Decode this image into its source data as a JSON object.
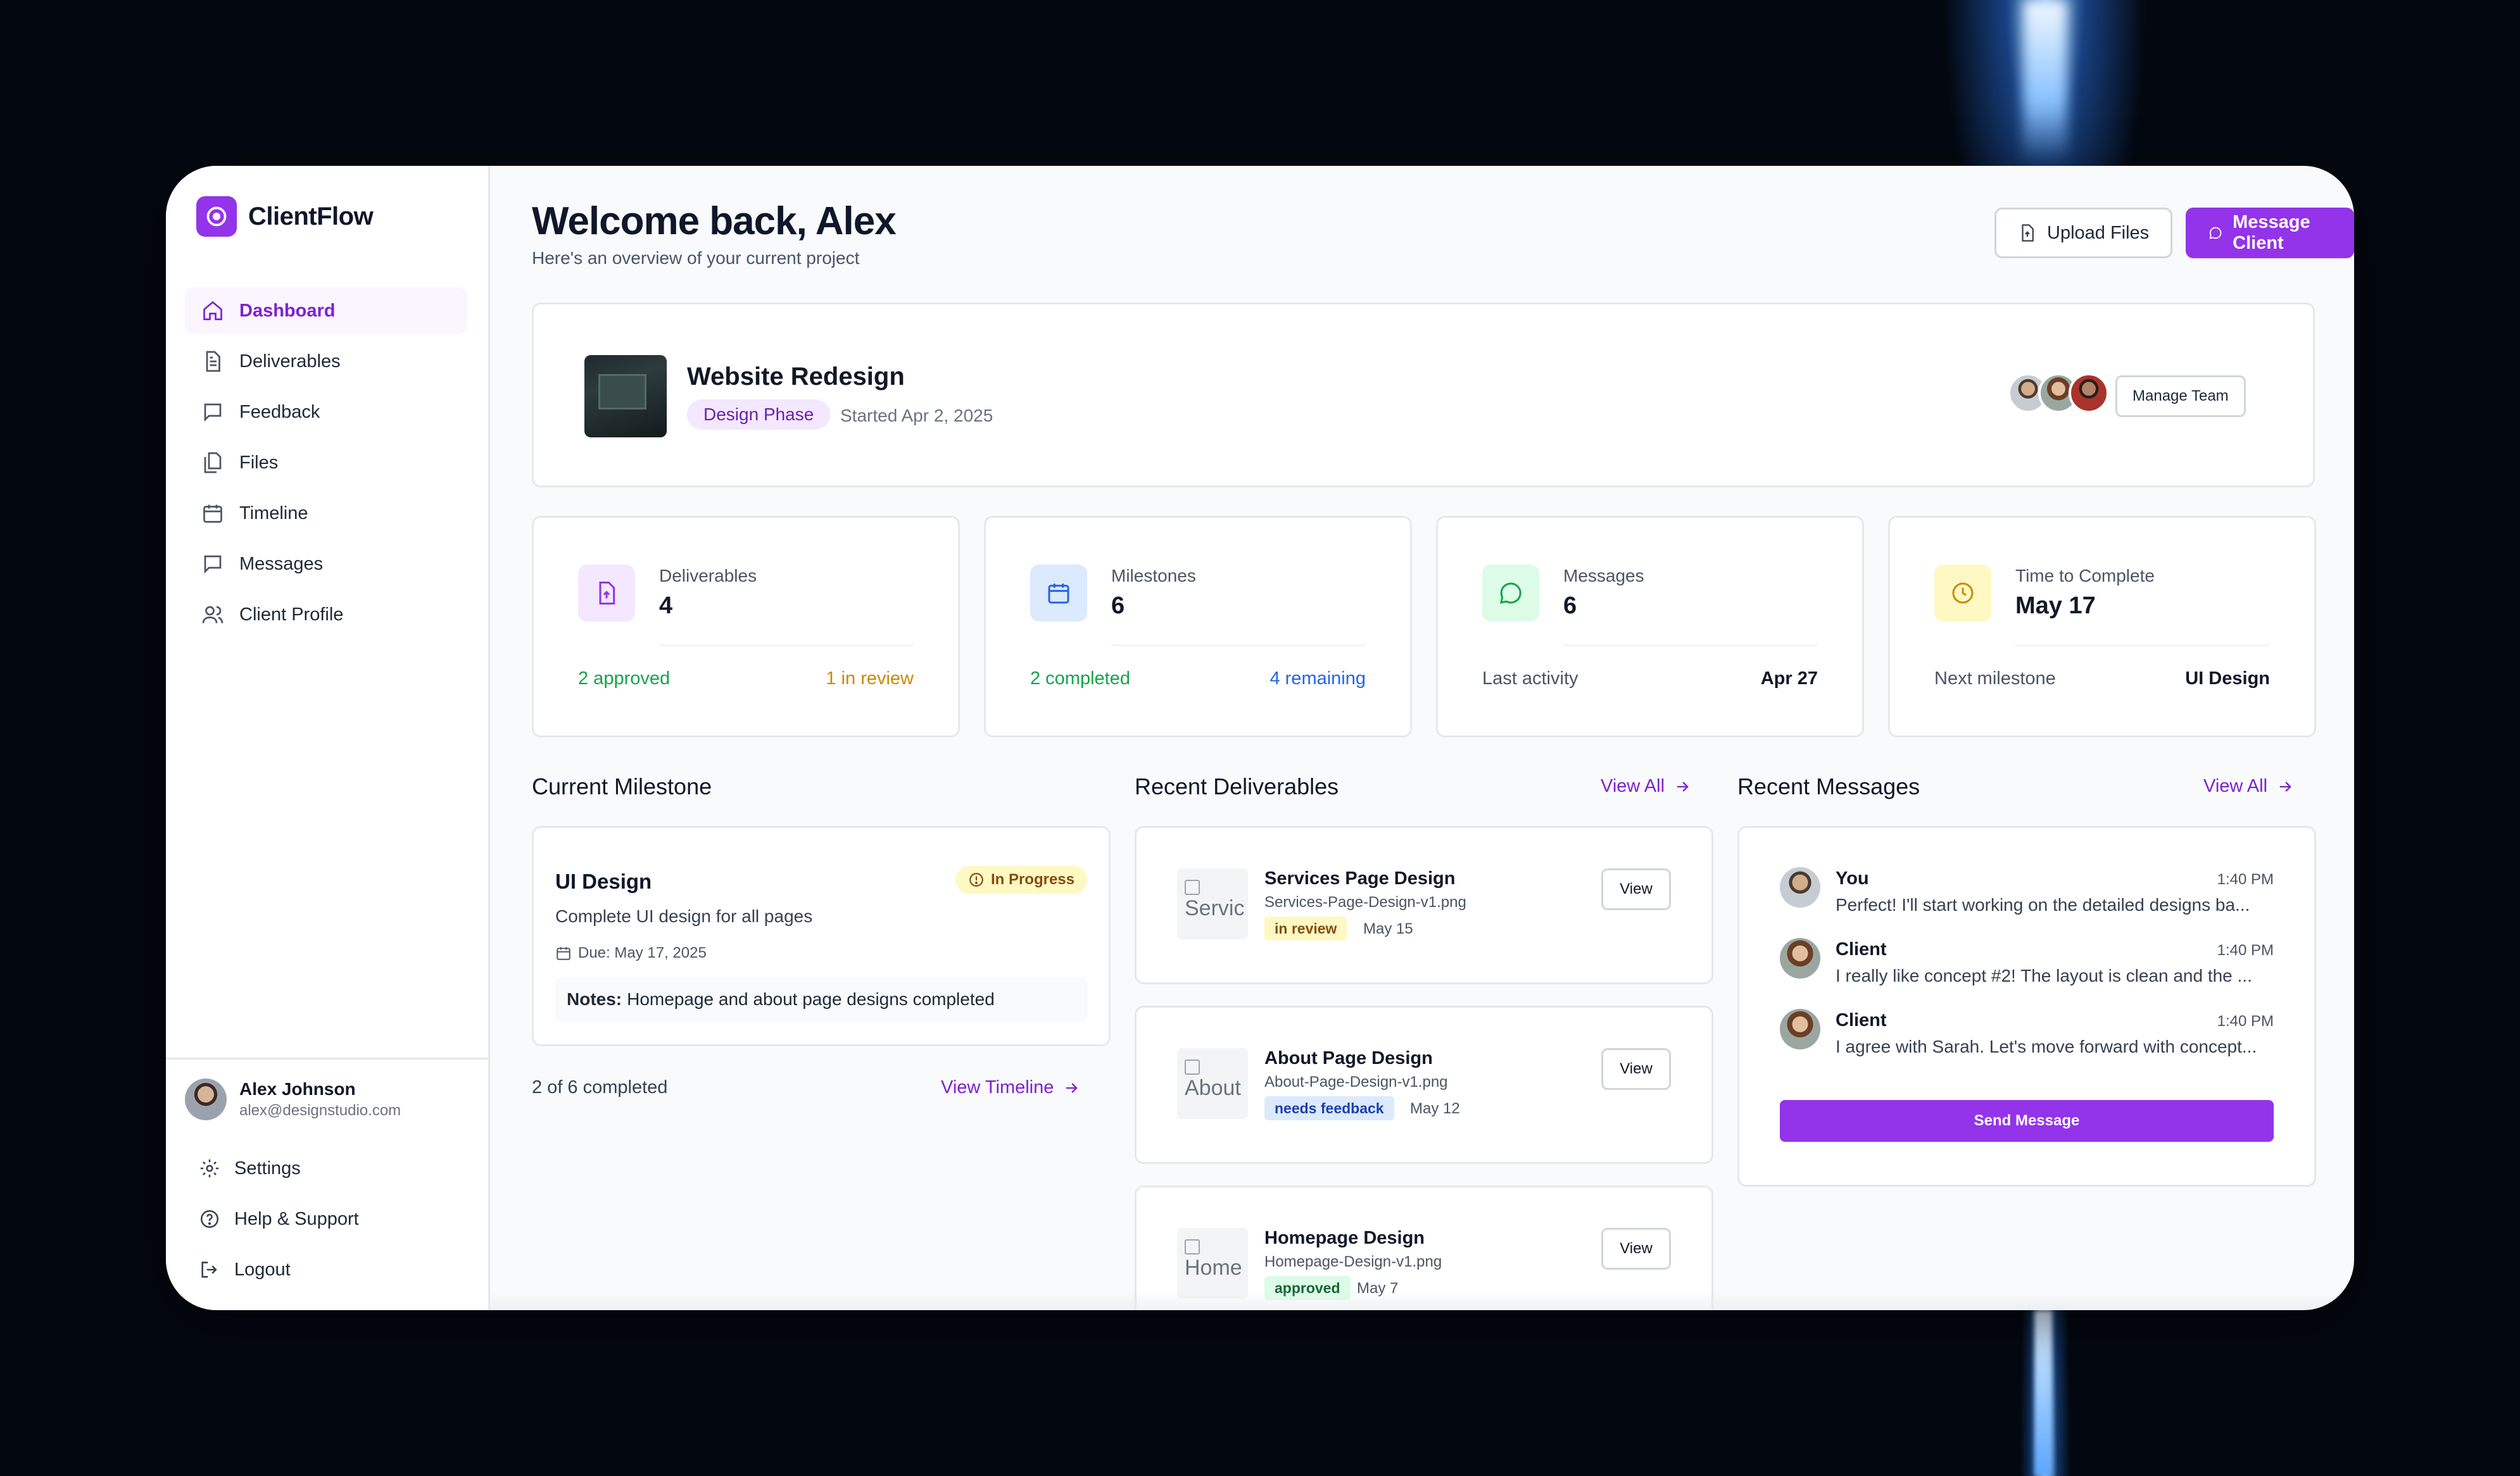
{
  "brand": {
    "name": "ClientFlow",
    "color": "#9333ea"
  },
  "sidebar": {
    "items": [
      {
        "label": "Dashboard",
        "icon": "home-icon",
        "active": true
      },
      {
        "label": "Deliverables",
        "icon": "document-icon"
      },
      {
        "label": "Feedback",
        "icon": "chat-icon"
      },
      {
        "label": "Files",
        "icon": "files-icon"
      },
      {
        "label": "Timeline",
        "icon": "calendar-icon"
      },
      {
        "label": "Messages",
        "icon": "message-icon"
      },
      {
        "label": "Client Profile",
        "icon": "users-icon"
      }
    ],
    "user": {
      "name": "Alex Johnson",
      "email": "alex@designstudio.com"
    },
    "bottom": [
      {
        "label": "Settings",
        "icon": "gear-icon"
      },
      {
        "label": "Help & Support",
        "icon": "help-icon"
      },
      {
        "label": "Logout",
        "icon": "logout-icon"
      }
    ]
  },
  "header": {
    "title": "Welcome back, Alex",
    "subtitle": "Here's an overview of your current project",
    "upload_label": "Upload Files",
    "message_label": "Message Client"
  },
  "project": {
    "title": "Website Redesign",
    "phase": "Design Phase",
    "started": "Started Apr 2, 2025",
    "manage_label": "Manage Team"
  },
  "stats": [
    {
      "label": "Deliverables",
      "value": "4",
      "icon": "upload-doc-icon",
      "foot_left": "2 approved",
      "foot_right": "1 in review"
    },
    {
      "label": "Milestones",
      "value": "6",
      "icon": "calendar-icon",
      "foot_left": "2 completed",
      "foot_right": "4 remaining"
    },
    {
      "label": "Messages",
      "value": "6",
      "icon": "chat-bubble-icon",
      "foot_left": "Last activity",
      "foot_right": "Apr 27"
    },
    {
      "label": "Time to Complete",
      "value": "May 17",
      "icon": "clock-icon",
      "foot_left": "Next milestone",
      "foot_right": "UI Design"
    }
  ],
  "milestone": {
    "section_title": "Current Milestone",
    "title": "UI Design",
    "status": "In Progress",
    "description": "Complete UI design for all pages",
    "due": "Due: May 17, 2025",
    "notes_label": "Notes:",
    "notes": "Homepage and about page designs completed",
    "progress": "2 of 6 completed",
    "view_timeline": "View Timeline"
  },
  "deliverables": {
    "section_title": "Recent Deliverables",
    "view_all": "View All",
    "items": [
      {
        "title": "Services Page Design",
        "file": "Services-Page-Design-v1.png",
        "alt": "Servic",
        "status": "in review",
        "date": "May 15",
        "view": "View"
      },
      {
        "title": "About Page Design",
        "file": "About-Page-Design-v1.png",
        "alt": "About",
        "status": "needs feedback",
        "date": "May 12",
        "view": "View"
      },
      {
        "title": "Homepage Design",
        "file": "Homepage-Design-v1.png",
        "alt": "Home",
        "status": "approved",
        "date": "May 7",
        "view": "View"
      }
    ]
  },
  "messages": {
    "section_title": "Recent Messages",
    "view_all": "View All",
    "items": [
      {
        "from": "You",
        "time": "1:40 PM",
        "text": "Perfect! I'll start working on the detailed designs ba..."
      },
      {
        "from": "Client",
        "time": "1:40 PM",
        "text": "I really like concept #2! The layout is clean and the ..."
      },
      {
        "from": "Client",
        "time": "1:40 PM",
        "text": "I agree with Sarah. Let's move forward with concept..."
      }
    ],
    "send_label": "Send Message"
  }
}
